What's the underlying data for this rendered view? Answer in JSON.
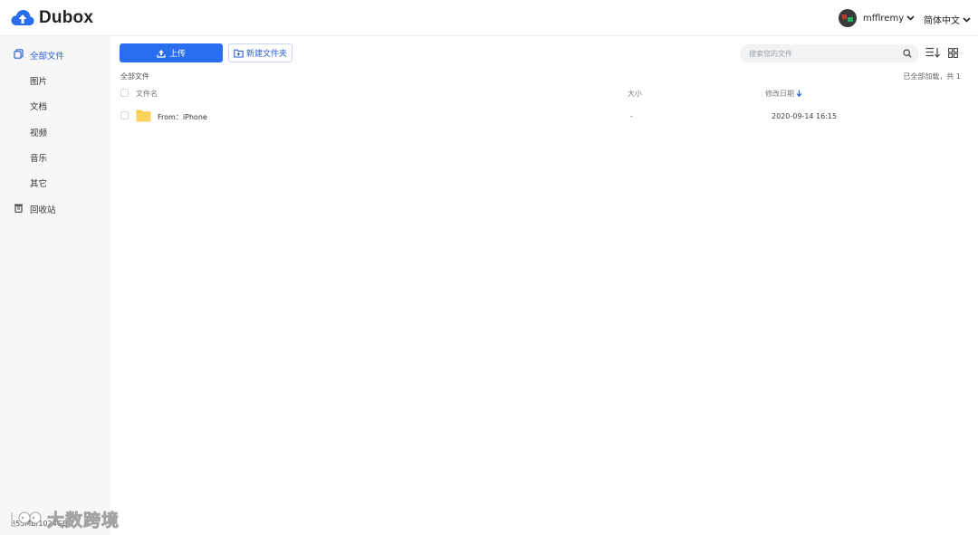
{
  "header": {
    "brand": "Dubox",
    "username": "mfflremy",
    "language": "简体中文"
  },
  "sidebar": {
    "items": [
      {
        "label": "全部文件",
        "icon": "files-icon",
        "active": true
      },
      {
        "label": "图片"
      },
      {
        "label": "文档"
      },
      {
        "label": "视频"
      },
      {
        "label": "音乐"
      },
      {
        "label": "其它"
      },
      {
        "label": "回收站",
        "icon": "trash-icon"
      }
    ],
    "storage": "855MB/1024GB"
  },
  "toolbar": {
    "upload_label": "上传",
    "new_folder_label": "新建文件夹",
    "search_placeholder": "搜索您的文件"
  },
  "list": {
    "breadcrumb": "全部文件",
    "loaded_status": "已全部加载，共 1",
    "columns": {
      "name": "文件名",
      "size": "大小",
      "date": "修改日期"
    },
    "rows": [
      {
        "name": "From：iPhone",
        "size": "-",
        "date": "2020-09-14 16:15"
      }
    ]
  },
  "watermark": {
    "text": "大数跨境"
  },
  "colors": {
    "accent": "#2a6ef0",
    "active_text": "#2a62d6",
    "folder": "#f7c948",
    "sidebar_bg": "#f7f7f8"
  }
}
